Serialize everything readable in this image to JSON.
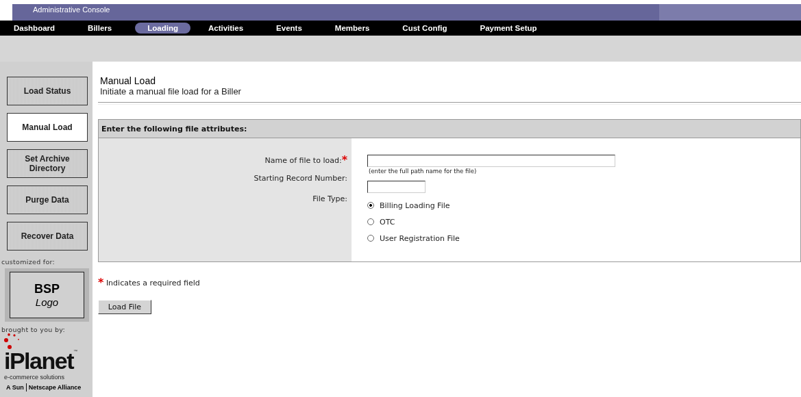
{
  "header": {
    "title": "Administrative Console"
  },
  "nav": [
    {
      "label": "Dashboard",
      "selected": false
    },
    {
      "label": "Billers",
      "selected": false
    },
    {
      "label": "Loading",
      "selected": true
    },
    {
      "label": "Activities",
      "selected": false
    },
    {
      "label": "Events",
      "selected": false
    },
    {
      "label": "Members",
      "selected": false
    },
    {
      "label": "Cust Config",
      "selected": false
    },
    {
      "label": "Payment Setup",
      "selected": false
    }
  ],
  "sidebar": {
    "items": [
      {
        "label": "Load Status",
        "selected": false
      },
      {
        "label": "Manual Load",
        "selected": true
      },
      {
        "label": "Set Archive Directory",
        "selected": false
      },
      {
        "label": "Purge Data",
        "selected": false
      },
      {
        "label": "Recover Data",
        "selected": false
      }
    ],
    "customized_label": "customized for:",
    "logo_title": "BSP",
    "logo_subtitle": "Logo",
    "brought_label": "brought to you by:",
    "brand": "iPlanet",
    "brand_mark": "™",
    "brand_tagline": "e-commerce solutions",
    "alliance_left": "A Sun",
    "alliance_right": "Netscape Alliance"
  },
  "page": {
    "title": "Manual Load",
    "subtitle": "Initiate a manual file load for a Biller"
  },
  "form": {
    "heading": "Enter the following file attributes:",
    "file_name": {
      "label": "Name of file to load:",
      "required_mark": "*",
      "hint": "(enter the full path name for the file)"
    },
    "start_record": {
      "label": "Starting Record Number:"
    },
    "file_type": {
      "label": "File Type:",
      "options": [
        {
          "label": "Billing Loading File",
          "selected": true
        },
        {
          "label": "OTC",
          "selected": false
        },
        {
          "label": "User Registration File",
          "selected": false
        }
      ]
    }
  },
  "required_note": {
    "mark": "*",
    "text": "Indicates a required field"
  },
  "submit": "Load File"
}
